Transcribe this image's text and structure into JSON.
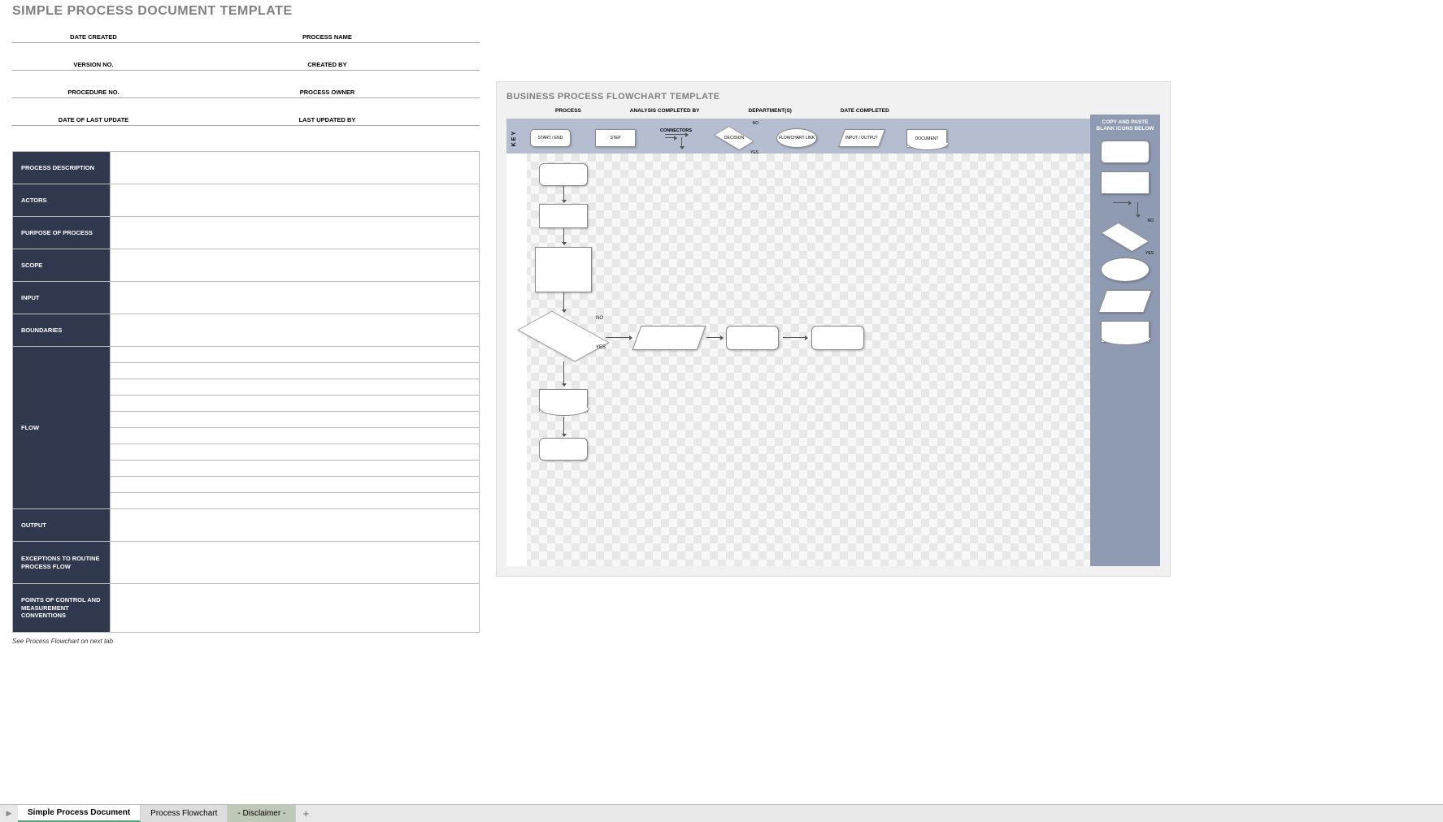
{
  "doc": {
    "title": "SIMPLE PROCESS DOCUMENT TEMPLATE",
    "meta": {
      "date_created": "DATE CREATED",
      "process_name": "PROCESS NAME",
      "version_no": "VERSION NO.",
      "created_by": "CREATED BY",
      "procedure_no": "PROCEDURE NO.",
      "process_owner": "PROCESS OWNER",
      "date_last_update": "DATE OF LAST UPDATE",
      "last_updated_by": "LAST UPDATED BY"
    },
    "sections": {
      "process_description": "PROCESS DESCRIPTION",
      "actors": "ACTORS",
      "purpose": "PURPOSE OF PROCESS",
      "scope": "SCOPE",
      "input": "INPUT",
      "boundaries": "BOUNDARIES",
      "flow": "FLOW",
      "output": "OUTPUT",
      "exceptions": "EXCEPTIONS TO ROUTINE PROCESS FLOW",
      "points": "POINTS OF CONTROL AND MEASUREMENT CONVENTIONS"
    },
    "footnote": "See Process Flowchart on next tab"
  },
  "flowchart": {
    "title": "BUSINESS PROCESS FLOWCHART TEMPLATE",
    "meta": {
      "process": "PROCESS",
      "analysis_by": "ANALYSIS COMPLETED BY",
      "department": "DEPARTMENT(S)",
      "date_completed": "DATE COMPLETED"
    },
    "key_label": "KEY",
    "key": {
      "start_end": "START / END",
      "step": "STEP",
      "connectors": "CONNECTORS",
      "decision": "DECISION",
      "no": "NO",
      "yes": "YES",
      "flowchart_link": "FLOWCHART LINK",
      "input_output": "INPUT / OUTPUT",
      "document": "DOCUMENT"
    },
    "palette_title": "COPY AND PASTE BLANK ICONS BELOW",
    "canvas": {
      "no": "NO",
      "yes": "YES"
    }
  },
  "tabs": {
    "t1": "Simple Process Document",
    "t2": "Process Flowchart",
    "t3": "- Disclaimer -",
    "add": "+",
    "nav": "▶"
  }
}
